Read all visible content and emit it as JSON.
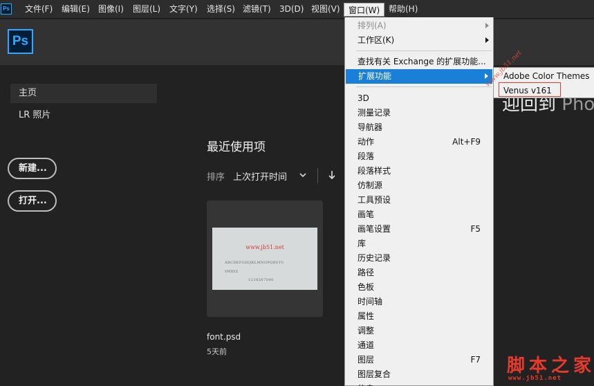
{
  "menubar": {
    "app_icon": "Ps",
    "items": [
      "文件(F)",
      "编辑(E)",
      "图像(I)",
      "图层(L)",
      "文字(Y)",
      "选择(S)",
      "滤镜(T)",
      "3D(D)",
      "视图(V)",
      "窗口(W)",
      "帮助(H)"
    ],
    "active_index": 9
  },
  "header": {
    "logo": "Ps"
  },
  "sidebar": {
    "items": [
      "主页",
      "LR 照片"
    ],
    "selected_index": 0,
    "new_button": "新建...",
    "open_button": "打开..."
  },
  "main": {
    "welcome_text": "迎回到 ",
    "welcome_suffix": "Pho",
    "section_title": "最近使用项",
    "sort_label": "排序",
    "sort_value": "上次打开时间",
    "sort_direction_icon": "arrow-down-icon",
    "recent_files": [
      {
        "name": "font.psd",
        "time": "5天前",
        "thumb_lines": [
          "www.jb51.net",
          "ABCDEFGHIJKLMNOPQRSTU",
          "VWXYZ",
          "1234567890"
        ]
      }
    ]
  },
  "window_menu": {
    "items": [
      {
        "label": "排列(A)",
        "disabled": true,
        "submenu": true
      },
      {
        "label": "工作区(K)",
        "submenu": true
      },
      {
        "separator": true
      },
      {
        "label": "查找有关 Exchange 的扩展功能..."
      },
      {
        "label": "扩展功能",
        "submenu": true,
        "highlighted": true
      },
      {
        "separator": true
      },
      {
        "label": "3D"
      },
      {
        "label": "测量记录"
      },
      {
        "label": "导航器"
      },
      {
        "label": "动作",
        "shortcut": "Alt+F9"
      },
      {
        "label": "段落"
      },
      {
        "label": "段落样式"
      },
      {
        "label": "仿制源"
      },
      {
        "label": "工具预设"
      },
      {
        "label": "画笔"
      },
      {
        "label": "画笔设置",
        "shortcut": "F5"
      },
      {
        "label": "库"
      },
      {
        "label": "历史记录"
      },
      {
        "label": "路径"
      },
      {
        "label": "色板"
      },
      {
        "label": "时间轴"
      },
      {
        "label": "属性"
      },
      {
        "label": "调整"
      },
      {
        "label": "通道"
      },
      {
        "label": "图层",
        "shortcut": "F7"
      },
      {
        "label": "图层复合"
      },
      {
        "label": "信息"
      }
    ]
  },
  "extensions_submenu": {
    "items": [
      "Adobe Color Themes",
      "Venus v161"
    ],
    "annotated_item_index": 1
  },
  "watermark": {
    "diagonal": "www.jb51.net",
    "logo": "脚本之家",
    "url": "www.jb51.net"
  }
}
